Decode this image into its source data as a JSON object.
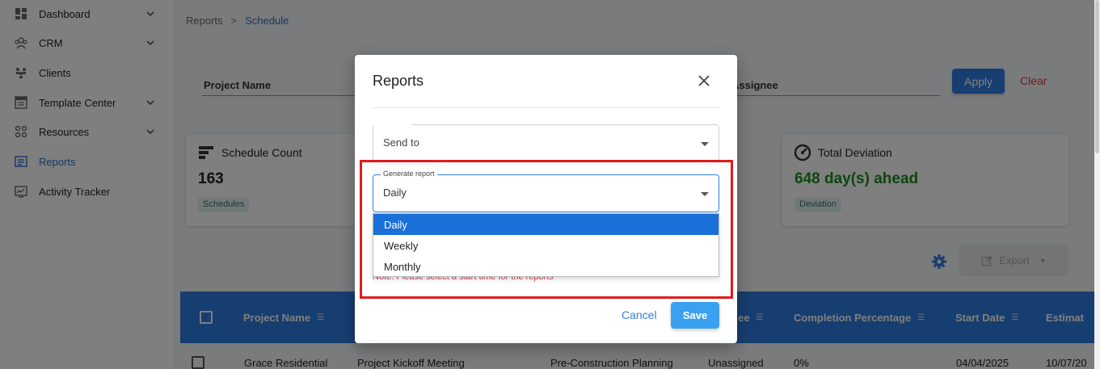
{
  "sidebar": {
    "items": [
      {
        "label": "Dashboard",
        "icon": "dashboard-icon",
        "has_chevron": true
      },
      {
        "label": "CRM",
        "icon": "crm-icon",
        "has_chevron": true
      },
      {
        "label": "Clients",
        "icon": "clients-icon",
        "has_chevron": false
      },
      {
        "label": "Template Center",
        "icon": "template-icon",
        "has_chevron": true
      },
      {
        "label": "Resources",
        "icon": "resources-icon",
        "has_chevron": true
      },
      {
        "label": "Reports",
        "icon": "reports-icon",
        "has_chevron": false,
        "active": true
      },
      {
        "label": "Activity Tracker",
        "icon": "activity-icon",
        "has_chevron": false
      }
    ]
  },
  "breadcrumb": {
    "root": "Reports",
    "separator": ">",
    "current": "Schedule"
  },
  "filters": {
    "project_name": "Project Name",
    "assignee": "Assignee",
    "apply": "Apply",
    "clear": "Clear"
  },
  "cards": {
    "schedule": {
      "title": "Schedule Count",
      "value": "163",
      "badge": "Schedules"
    },
    "deviation": {
      "title": "Total Deviation",
      "value": "648 day(s) ahead",
      "badge": "Deviation"
    }
  },
  "toolbar": {
    "export": "Export"
  },
  "table": {
    "headers": [
      "Project Name",
      "ee",
      "Completion Percentage",
      "Start Date",
      "Estimat"
    ],
    "row": [
      "Grace Residential",
      "Project Kickoff Meeting",
      "Pre-Construction Planning",
      "Unassigned",
      "0%",
      "04/04/2025",
      "10/07/20"
    ]
  },
  "modal": {
    "title": "Reports",
    "send_to_label": "Send to",
    "generate_legend": "Generate report",
    "generate_value": "Daily",
    "options": [
      "Daily",
      "Weekly",
      "Monthly"
    ],
    "selected_option": "Daily",
    "note": "Note: Please select a start time for the reports",
    "cancel": "Cancel",
    "save": "Save"
  },
  "colors": {
    "primary": "#2f7de0",
    "danger": "#e0393e",
    "highlight": "#e01c1c",
    "positive": "#1e8b1e"
  }
}
